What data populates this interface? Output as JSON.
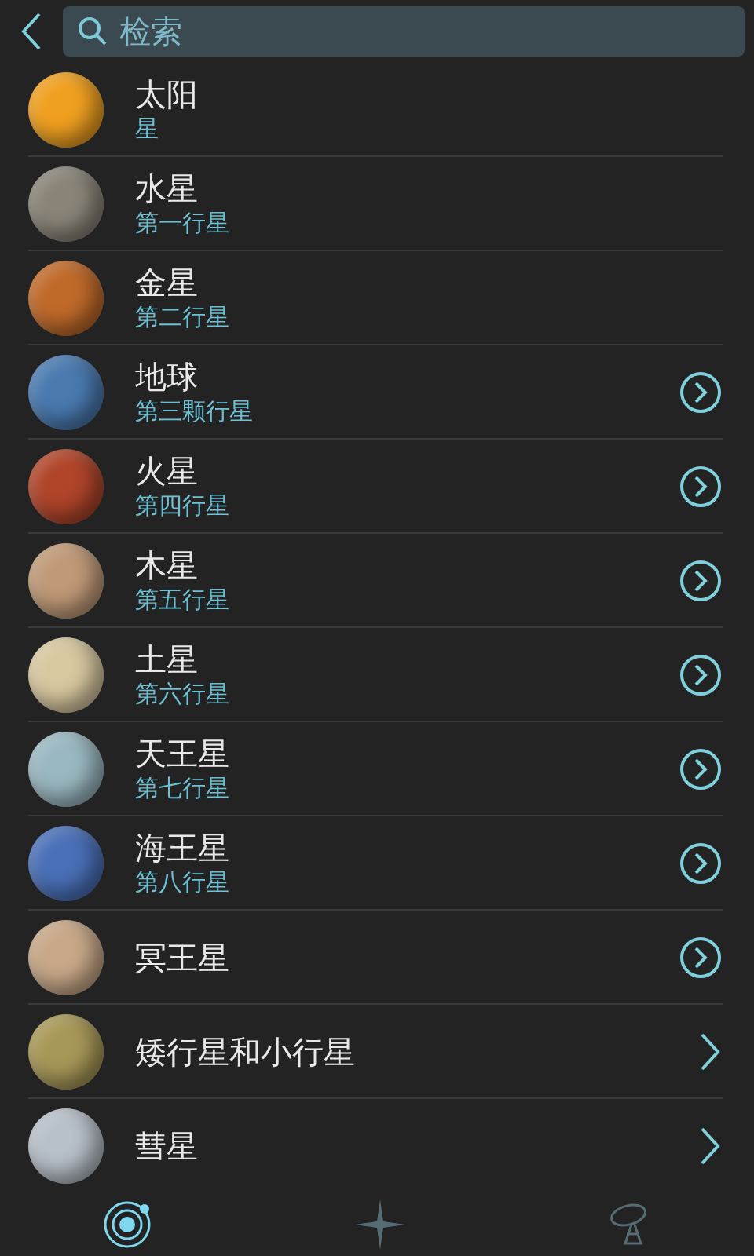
{
  "search": {
    "placeholder": "检索"
  },
  "items": [
    {
      "name": "太阳",
      "subtitle": "星",
      "color": "#f0a020",
      "kind": "none"
    },
    {
      "name": "水星",
      "subtitle": "第一行星",
      "color": "#8a8478",
      "kind": "none"
    },
    {
      "name": "金星",
      "subtitle": "第二行星",
      "color": "#c06a2a",
      "kind": "none"
    },
    {
      "name": "地球",
      "subtitle": "第三颗行星",
      "color": "#4a7ab0",
      "kind": "circle"
    },
    {
      "name": "火星",
      "subtitle": "第四行星",
      "color": "#b0452a",
      "kind": "circle"
    },
    {
      "name": "木星",
      "subtitle": "第五行星",
      "color": "#c09a78",
      "kind": "circle"
    },
    {
      "name": "土星",
      "subtitle": "第六行星",
      "color": "#d8c8a0",
      "kind": "circle"
    },
    {
      "name": "天王星",
      "subtitle": "第七行星",
      "color": "#9ab8c0",
      "kind": "circle"
    },
    {
      "name": "海王星",
      "subtitle": "第八行星",
      "color": "#4a70b8",
      "kind": "circle"
    },
    {
      "name": "冥王星",
      "color": "#c8a888",
      "kind": "circle"
    },
    {
      "name": "矮行星和小行星",
      "color": "#a89858",
      "kind": "plain"
    },
    {
      "name": "彗星",
      "color": "#b8c0c8",
      "kind": "plain"
    }
  ],
  "tabs": [
    {
      "kind": "orbit",
      "selected": true
    },
    {
      "kind": "star",
      "selected": false
    },
    {
      "kind": "probe",
      "selected": false
    }
  ]
}
